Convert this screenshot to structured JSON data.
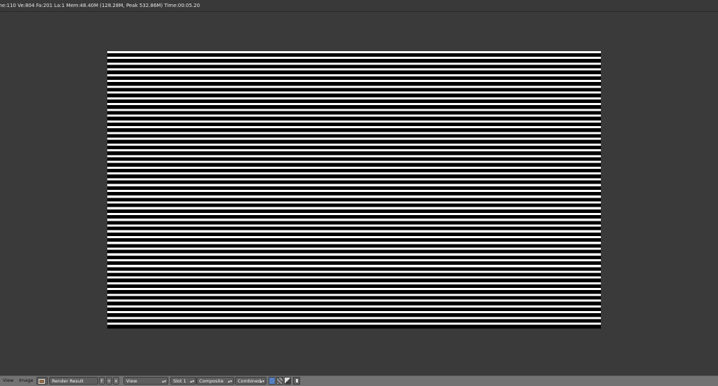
{
  "info_bar": {
    "text": "me:110 Ve:804 Fa:201 La:1 Mem:48.40M (128.28M, Peak 532.86M) Time:00:05.20"
  },
  "header": {
    "menus": {
      "view": "View",
      "image": "Image"
    },
    "image_datablock": "Render Result",
    "fake_user_label": "F",
    "new_label": "+",
    "unlink_label": "×",
    "draw_mode": "View",
    "slot": "Slot 1",
    "layer": "Composite",
    "pass": "Combined",
    "arrows": "▴▾"
  },
  "colors": {
    "background": "#3a3a3a",
    "header": "#727272",
    "accent": "#5680c2"
  },
  "icons": [
    "image-editor-icon",
    "image-icon",
    "alpha-checker-icon",
    "zbuffer-icon",
    "pin-icon"
  ]
}
